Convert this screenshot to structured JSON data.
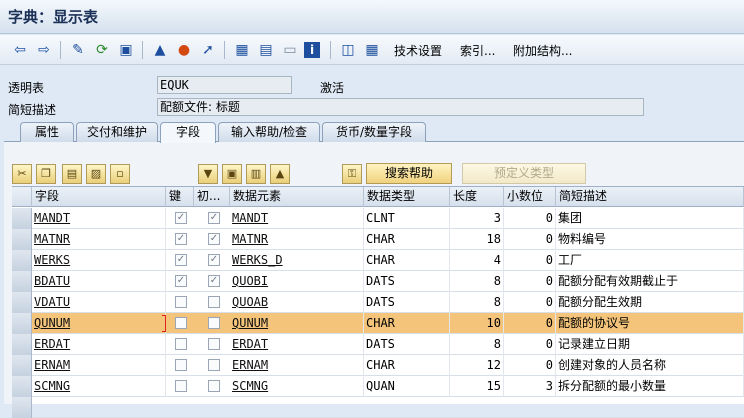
{
  "window": {
    "title": "字典：显示表"
  },
  "toolbar": {
    "icons": [
      "arrow-left-icon",
      "arrow-right-icon",
      "edit-pencil-icon",
      "other-object-icon",
      "check-icon",
      "activate-icon",
      "where-used-icon",
      "object-list-icon",
      "navigate-icon",
      "hierarchy-icon",
      "print-icon",
      "display-icon",
      "info-icon",
      "structure-icon",
      "table-icon"
    ],
    "tech_settings": "技术设置",
    "index": "索引...",
    "append_structure": "附加结构..."
  },
  "header": {
    "transparent_table_label": "透明表",
    "table_name": "EQUK",
    "status": "激活",
    "short_desc_label": "简短描述",
    "short_desc_value": "配额文件: 标题"
  },
  "tabs": [
    {
      "label": "属性"
    },
    {
      "label": "交付和维护"
    },
    {
      "label": "字段",
      "active": true
    },
    {
      "label": "输入帮助/检查"
    },
    {
      "label": "货币/数量字段"
    }
  ],
  "grid_toolbar": {
    "search_help": "搜索帮助",
    "predefined_type": "预定义类型"
  },
  "columns": [
    "字段",
    "键",
    "初...",
    "数据元素",
    "数据类型",
    "长度",
    "小数位",
    "简短描述"
  ],
  "rows": [
    {
      "field": "MANDT",
      "key": true,
      "init": true,
      "element": "MANDT",
      "type": "CLNT",
      "length": "3",
      "decimals": "0",
      "desc": "集团"
    },
    {
      "field": "MATNR",
      "key": true,
      "init": true,
      "element": "MATNR",
      "type": "CHAR",
      "length": "18",
      "decimals": "0",
      "desc": "物料编号"
    },
    {
      "field": "WERKS",
      "key": true,
      "init": true,
      "element": "WERKS_D",
      "type": "CHAR",
      "length": "4",
      "decimals": "0",
      "desc": "工厂"
    },
    {
      "field": "BDATU",
      "key": true,
      "init": true,
      "element": "QUOBI",
      "type": "DATS",
      "length": "8",
      "decimals": "0",
      "desc": "配额分配有效期截止于"
    },
    {
      "field": "VDATU",
      "key": false,
      "init": false,
      "element": "QUOAB",
      "type": "DATS",
      "length": "8",
      "decimals": "0",
      "desc": "配额分配生效期"
    },
    {
      "field": "QUNUM",
      "key": false,
      "init": false,
      "element": "QUNUM",
      "type": "CHAR",
      "length": "10",
      "decimals": "0",
      "desc": "配额的协议号",
      "selected": true
    },
    {
      "field": "ERDAT",
      "key": false,
      "init": false,
      "element": "ERDAT",
      "type": "DATS",
      "length": "8",
      "decimals": "0",
      "desc": "记录建立日期"
    },
    {
      "field": "ERNAM",
      "key": false,
      "init": false,
      "element": "ERNAM",
      "type": "CHAR",
      "length": "12",
      "decimals": "0",
      "desc": "创建对象的人员名称"
    },
    {
      "field": "SCMNG",
      "key": false,
      "init": false,
      "element": "SCMNG",
      "type": "QUAN",
      "length": "15",
      "decimals": "3",
      "desc": "拆分配额的最小数量"
    }
  ]
}
